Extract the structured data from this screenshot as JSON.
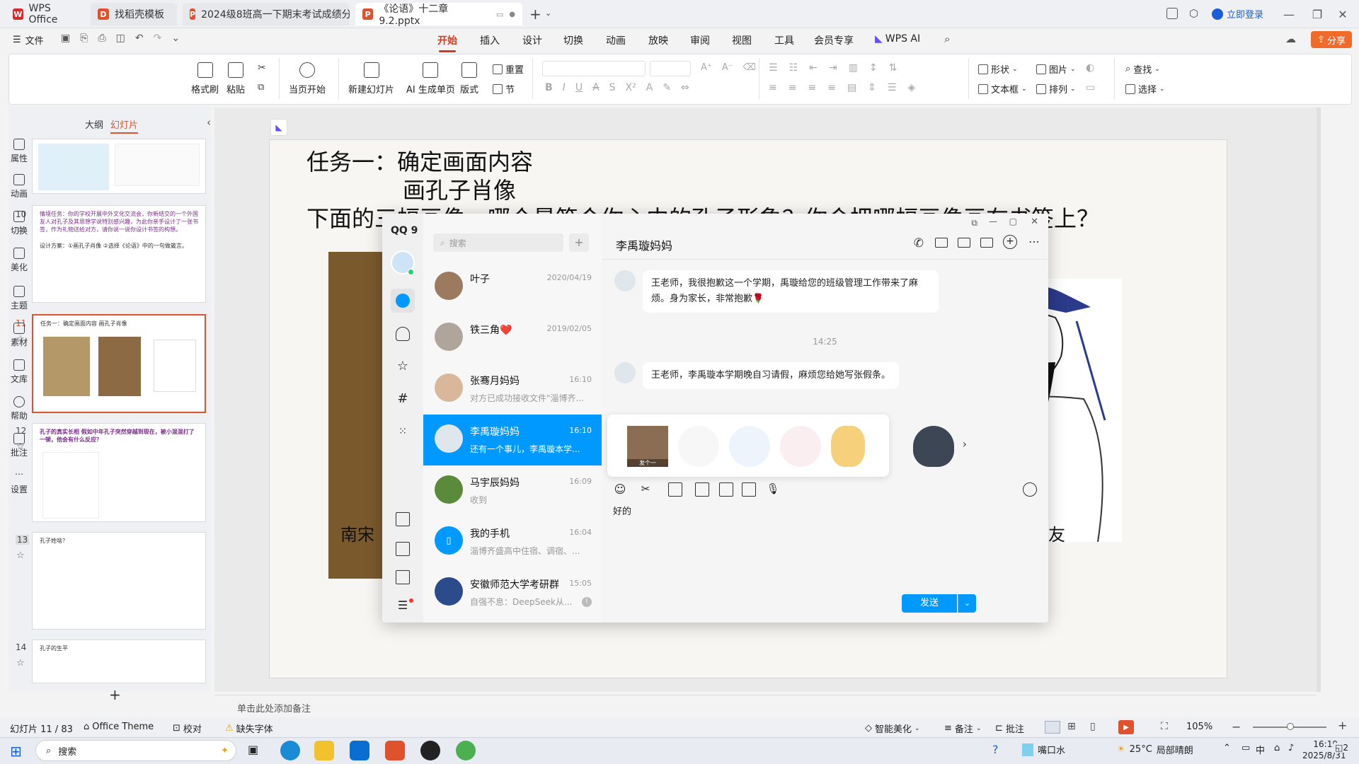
{
  "titlebar": {
    "tabs": [
      {
        "label": "WPS Office"
      },
      {
        "label": "找稻壳模板"
      },
      {
        "label": "2024级8班高一下期末考试成绩分析"
      },
      {
        "label": "《论语》十二章9.2.pptx"
      }
    ],
    "login": "立即登录"
  },
  "menubar": {
    "file": "文件",
    "items": [
      "开始",
      "插入",
      "设计",
      "切换",
      "动画",
      "放映",
      "审阅",
      "视图",
      "工具",
      "会员专享",
      "WPS AI"
    ],
    "share": "分享"
  },
  "ribbon": {
    "format_painter": "格式刷",
    "paste": "粘贴",
    "play_current": "当页开始",
    "new_slide": "新建幻灯片",
    "ai_single": "AI 生成单页",
    "layout": "版式",
    "reset": "重置",
    "section": "节",
    "shape": "形状",
    "picture": "图片",
    "textbox": "文本框",
    "arrange": "排列",
    "find": "查找",
    "select": "选择"
  },
  "leftpanel": {
    "tab_outline": "大纲",
    "tab_slides": "幻灯片",
    "slide_numbers": [
      "10",
      "11",
      "12",
      "13",
      "14"
    ],
    "slide10_text": "情境任务：你的学校开展中外文化交流会，你新结交的一个外国友人对孔子及其思想学说特别感兴趣，为此你亲手设计了一张书签，作为礼物送给对方，请你说一说你设计书签的构想。",
    "slide10_plan": "设计方案：①画孔子肖像 ②选择《论语》中的一句做箴言。",
    "slide11_text": "任务一：确定画面内容 画孔子肖像",
    "slide12_text": "孔子的真实长相 假如中年孔子突然穿越到现在，被小混混打了一顿，他会有什么反应？",
    "slide13_text": "孔子姓啥？",
    "slide14_text": "孔子的生平",
    "add": "+"
  },
  "slide": {
    "title1": "任务一：确定画面内容",
    "title2": "画孔子肖像",
    "question": "下面的三幅画像，哪个最符合你心中的孔子形象？你会把哪幅画像画在书签上？",
    "caption_left": "南宋",
    "caption_right": "友"
  },
  "qq": {
    "brand": "QQ 9",
    "search_placeholder": "搜索",
    "contacts": [
      {
        "name": "叶子",
        "time": "2020/04/19",
        "preview": ""
      },
      {
        "name": "铁三角❤️",
        "time": "2019/02/05",
        "preview": ""
      },
      {
        "name": "张骞月妈妈",
        "time": "16:10",
        "preview": "对方已成功接收文件\"淄博齐..."
      },
      {
        "name": "李禹璇妈妈",
        "time": "16:10",
        "preview": "还有一个事儿，李禹璇本学..."
      },
      {
        "name": "马宇辰妈妈",
        "time": "16:09",
        "preview": "收到"
      },
      {
        "name": "我的手机",
        "time": "16:04",
        "preview": "淄博齐盛高中住宿、调宿、..."
      },
      {
        "name": "安徽师范大学考研群",
        "time": "15:05",
        "preview": "自强不息：DeepSeek从..."
      }
    ],
    "chat_title": "李禹璇妈妈",
    "messages": [
      {
        "text": "王老师，我很抱歉这一个学期，禹璇给您的班级管理工作带来了麻烦。身为家长，非常抱歉🌹"
      },
      {
        "text": "王老师，李禹璇本学期晚自习请假，麻烦您给她写张假条。"
      }
    ],
    "time_divider": "14:25",
    "sticker_caption": "发个一",
    "input_text": "好的",
    "send": "发送"
  },
  "rightbar": [
    "属性",
    "动画",
    "切换",
    "美化",
    "主题",
    "素材",
    "文库",
    "帮助",
    "批注",
    "设置"
  ],
  "notes_placeholder": "单击此处添加备注",
  "status": {
    "slide_count": "幻灯片 11 / 83",
    "theme": "Office Theme",
    "proof": "校对",
    "missing_font": "缺失字体",
    "beautify": "智能美化",
    "notes": "备注",
    "comments": "批注",
    "zoom": "105%"
  },
  "taskbar": {
    "search": "搜索",
    "weather_place": "嘴口水",
    "temperature": "25°C",
    "weather": "局部晴朗",
    "ime": "中",
    "time": "16:19",
    "date": "2025/8/31",
    "notif_count": "2"
  },
  "colors": {
    "accent": "#d13b20",
    "qq_blue": "#0099ff",
    "wps_red": "#e0522e"
  }
}
